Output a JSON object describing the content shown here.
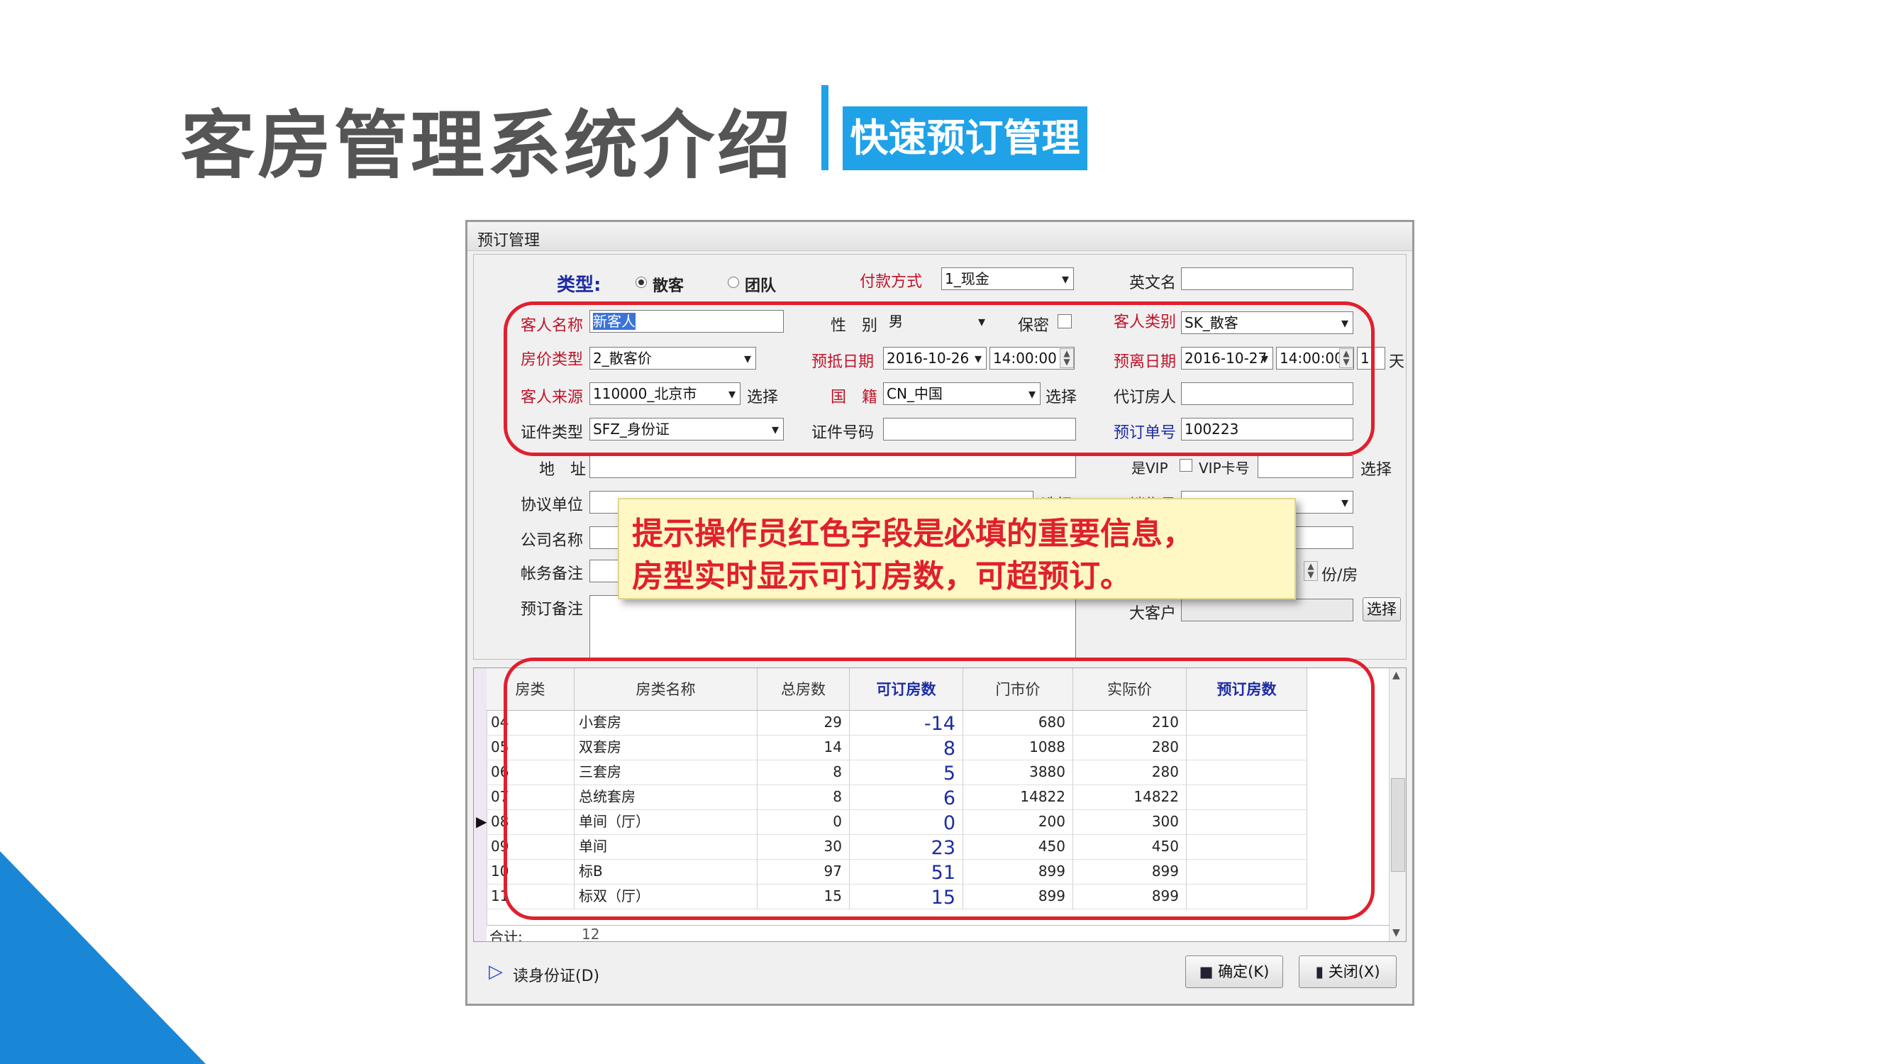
{
  "slide": {
    "title": "客房管理系统介绍",
    "subtitle": "快速预订管理",
    "accent_color": "#1fa2e8"
  },
  "window": {
    "title": "预订管理",
    "type_label": "类型:",
    "type_options": [
      "散客",
      "团队"
    ],
    "selected_type": "散客",
    "payment_label": "付款方式",
    "payment_value": "1_现金",
    "english_name_label": "英文名",
    "english_name_value": "",
    "guest_name_label": "客人名称",
    "guest_name_value": "新客人",
    "gender_label": "性　别",
    "gender_value": "男",
    "secret_label": "保密",
    "guest_category_label": "客人类别",
    "guest_category_value": "SK_散客",
    "rate_type_label": "房价类型",
    "rate_type_value": "2_散客价",
    "arrival_label": "预抵日期",
    "arrival_date": "2016-10-26",
    "arrival_time": "14:00:00",
    "departure_label": "预离日期",
    "departure_date": "2016-10-27",
    "departure_time": "14:00:00",
    "nights_value": "1",
    "nights_unit": "天",
    "source_label": "客人来源",
    "source_value": "110000_北京市",
    "select_label": "选择",
    "nationality_label": "国　籍",
    "nationality_value": "CN_中国",
    "booker_label": "代订房人",
    "booker_value": "",
    "id_type_label": "证件类型",
    "id_type_value": "SFZ_身份证",
    "id_number_label": "证件号码",
    "id_number_value": "",
    "booking_no_label": "预订单号",
    "booking_no_value": "100223",
    "address_label": "地　址",
    "vip_label": "是VIP",
    "vip_card_label": "VIP卡号",
    "agreement_label": "协议单位",
    "agreement_select": "选择",
    "sales_label": "销售员",
    "company_label": "公司名称",
    "account_note_label": "帐务备注",
    "per_room_label": "份/房",
    "booking_note_label": "预订备注",
    "big_customer_label": "大客户"
  },
  "grid": {
    "columns": [
      "房类",
      "房类名称",
      "总房数",
      "可订房数",
      "门市价",
      "实际价",
      "预订房数"
    ],
    "highlight_columns": [
      "可订房数",
      "预订房数"
    ],
    "rows": [
      {
        "code": "04",
        "name": "小套房",
        "total": "29",
        "available": "-14",
        "rack": "680",
        "actual": "210",
        "booked": ""
      },
      {
        "code": "05",
        "name": "双套房",
        "total": "14",
        "available": "8",
        "rack": "1088",
        "actual": "280",
        "booked": ""
      },
      {
        "code": "06",
        "name": "三套房",
        "total": "8",
        "available": "5",
        "rack": "3880",
        "actual": "280",
        "booked": ""
      },
      {
        "code": "07",
        "name": "总统套房",
        "total": "8",
        "available": "6",
        "rack": "14822",
        "actual": "14822",
        "booked": ""
      },
      {
        "code": "08",
        "name": "单间（厅）",
        "total": "0",
        "available": "0",
        "rack": "200",
        "actual": "300",
        "booked": ""
      },
      {
        "code": "09",
        "name": "单间",
        "total": "30",
        "available": "23",
        "rack": "450",
        "actual": "450",
        "booked": ""
      },
      {
        "code": "10",
        "name": "标B",
        "total": "97",
        "available": "51",
        "rack": "899",
        "actual": "899",
        "booked": ""
      },
      {
        "code": "11",
        "name": "标双（厅）",
        "total": "15",
        "available": "15",
        "rack": "899",
        "actual": "899",
        "booked": ""
      }
    ],
    "total_label": "合计:",
    "total_value": "12"
  },
  "footer": {
    "read_id_label": "读身份证(D)",
    "ok_label": "确定(K)",
    "close_label": "关闭(X)"
  },
  "callout": {
    "line1": "提示操作员红色字段是必填的重要信息，",
    "line2": "房型实时显示可订房数，可超预订。"
  }
}
